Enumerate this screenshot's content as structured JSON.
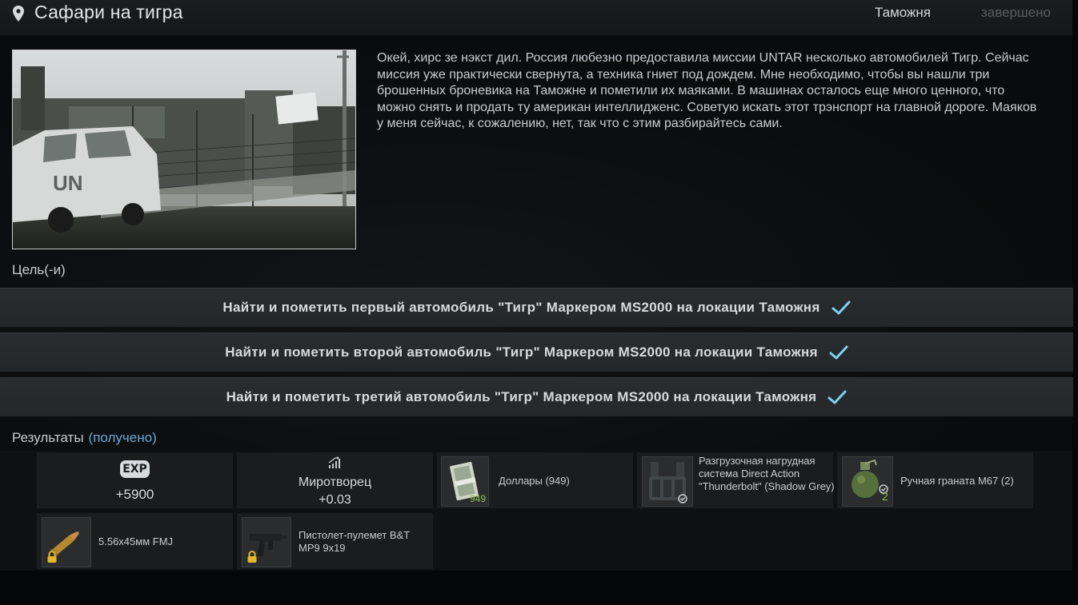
{
  "header": {
    "title": "Сафари на тигра",
    "location": "Таможня",
    "status": "завершено"
  },
  "description": "Окей, хирс зе нэкст дил. Россия любезно предоставила миссии UNTAR несколько автомобилей Тигр. Сейчас миссия уже практически свернута, а техника гниет под дождем. Мне необходимо, чтобы вы нашли три брошенных броневика на Таможне и пометили их маяками. В машинах осталось еще много ценного, что можно снять и продать ту американ интеллидженс. Советую искать этот трэнспорт на главной дороге. Маяков у меня сейчас, к сожалению, нет, так что с этим разбирайтесь сами.",
  "objectives_label": "Цель(-и)",
  "objectives": [
    "Найти и пометить первый автомобиль \"Тигр\" Маркером MS2000 на локации Таможня",
    "Найти и пометить второй автомобиль \"Тигр\" Маркером MS2000 на локации Таможня",
    "Найти и пометить третий автомобиль \"Тигр\" Маркером MS2000 на локации Таможня"
  ],
  "results_label": "Результаты",
  "results_status": "(получено)",
  "rewards": {
    "exp_badge": "EXP",
    "exp_value": "+5900",
    "standing_name": "Миротворец",
    "standing_value": "+0.03",
    "items": [
      {
        "label": "Доллары (949)",
        "count": "949",
        "icon": "dollars-icon"
      },
      {
        "label": "Разгрузочная нагрудная система Direct Action \"Thunderbolt\" (Shadow Grey)",
        "icon": "chest-rig-icon"
      },
      {
        "label": "Ручная граната М67 (2)",
        "count": "2",
        "icon": "grenade-icon"
      },
      {
        "label": "5.56x45мм FMJ",
        "icon": "ammo-icon"
      },
      {
        "label": "Пистолет-пулемет B&T MP9 9x19",
        "icon": "smg-icon"
      }
    ]
  },
  "colors": {
    "check": "#7fd0f0",
    "received": "#6da9d8",
    "accent_green": "#8fbf4a"
  }
}
